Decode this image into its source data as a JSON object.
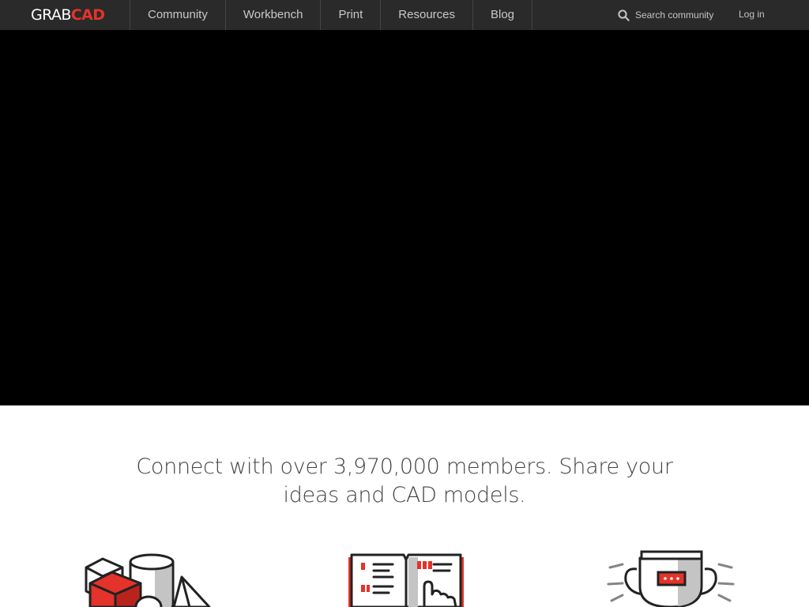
{
  "brand": {
    "part1": "GRAB",
    "part2": "CAD"
  },
  "nav": {
    "items": [
      "Community",
      "Workbench",
      "Print",
      "Resources",
      "Blog"
    ]
  },
  "search": {
    "label": "Search community"
  },
  "login": {
    "label": "Log in"
  },
  "main": {
    "tagline": "Connect with over 3,970,000 members. Share your ideas and CAD models."
  },
  "features": [
    {
      "icon": "cad-models-icon"
    },
    {
      "icon": "tutorials-book-icon"
    },
    {
      "icon": "trophy-challenges-icon"
    }
  ],
  "colors": {
    "topbar": "#2a2a2a",
    "brand_accent": "#e4332a",
    "hero": "#000000",
    "text": "#444444"
  }
}
